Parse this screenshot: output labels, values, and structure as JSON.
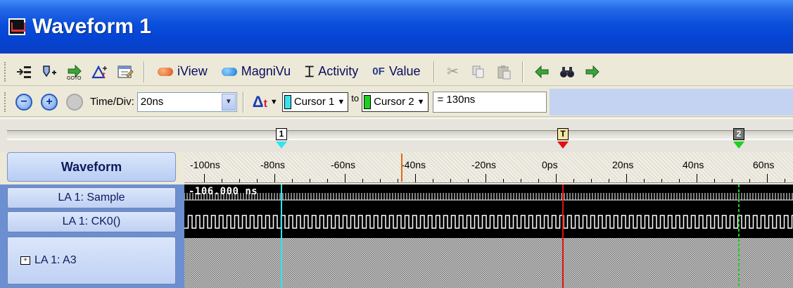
{
  "window": {
    "title": "Waveform 1"
  },
  "toolbar1": {
    "iview_label": "iView",
    "magnivu_label": "MagniVu",
    "activity_label": "Activity",
    "value_prefix": "0F",
    "value_label": "Value"
  },
  "toolbar2": {
    "timediv_label": "Time/Div:",
    "timediv_value": "20ns",
    "cursor_a": "Cursor 1",
    "to_label": "to",
    "cursor_b": "Cursor 2",
    "delta_value": "= 130ns"
  },
  "cursors": {
    "c1_label": "1",
    "trigger_label": "T",
    "c2_label": "2",
    "c1_color": "#35e3f0",
    "trigger_color": "#e11010",
    "c2_color": "#1fcf1f"
  },
  "header": {
    "waveform_label": "Waveform"
  },
  "time_axis": {
    "ticks": [
      "-100ns",
      "-80ns",
      "-60ns",
      "-40ns",
      "-20ns",
      "0ps",
      "20ns",
      "40ns",
      "60ns"
    ]
  },
  "signals": [
    {
      "name": "LA 1: Sample"
    },
    {
      "name": "LA 1: CK0()"
    },
    {
      "name": "LA 1: A3",
      "expand": "+"
    }
  ],
  "sample_readout": "-106.000 ns"
}
